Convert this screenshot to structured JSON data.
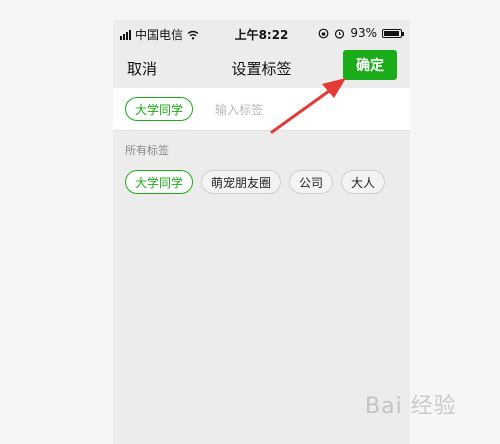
{
  "status_bar": {
    "carrier": "中国电信",
    "time": "上午8:22",
    "battery_percent": "93%",
    "battery_level": 0.93
  },
  "nav": {
    "cancel_label": "取消",
    "title": "设置标签",
    "confirm_label": "确定"
  },
  "input": {
    "selected_tag": "大学同学",
    "placeholder": "输入标签"
  },
  "all_tags": {
    "label": "所有标签",
    "items": [
      {
        "label": "大学同学",
        "selected": true
      },
      {
        "label": "萌宠朋友圈",
        "selected": false
      },
      {
        "label": "公司",
        "selected": false
      },
      {
        "label": "大人",
        "selected": false
      }
    ]
  },
  "watermark": "Bai 经验",
  "colors": {
    "accent": "#1aad19",
    "arrow": "#e53935"
  }
}
